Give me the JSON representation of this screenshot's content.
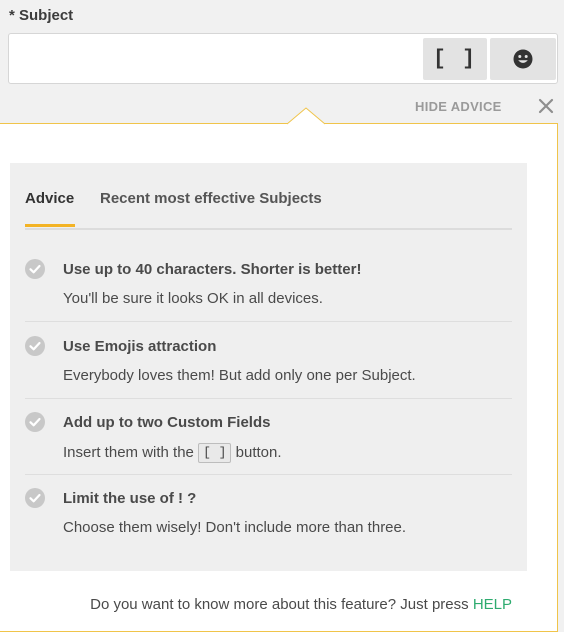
{
  "subject": {
    "label": "* Subject",
    "value": "",
    "custom_field_button_label": "[ ]",
    "emoji_icon": "smiley-icon"
  },
  "advice_toggle": {
    "label": "HIDE ADVICE",
    "close_icon": "close-icon"
  },
  "tabs": [
    {
      "label": "Advice",
      "active": true
    },
    {
      "label": "Recent most effective Subjects",
      "active": false
    }
  ],
  "advice": [
    {
      "title": "Use up to 40 characters. Shorter is better!",
      "desc": "You'll be sure it looks OK in all devices."
    },
    {
      "title": "Use Emojis attraction",
      "desc": "Everybody loves them! But add only one per Subject."
    },
    {
      "title": "Add up to two Custom Fields",
      "desc_before": "Insert them with the",
      "desc_kbd": "[ ]",
      "desc_after": "button."
    },
    {
      "title": "Limit the use of ! ?",
      "desc": "Choose them wisely! Don't include more than three."
    }
  ],
  "footer": {
    "text": "Do you want to know more about this feature? Just press",
    "link": "HELP"
  },
  "colors": {
    "accent": "#f3b325",
    "panel_border": "#f0c44a",
    "link": "#2eab6f",
    "check": "#c8c8c8"
  }
}
